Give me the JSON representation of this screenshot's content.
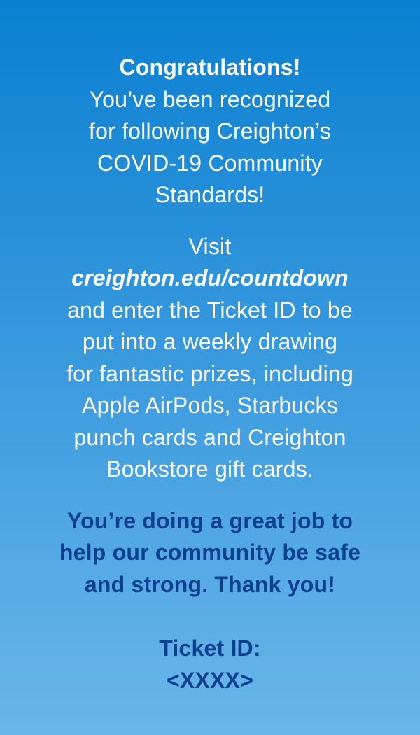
{
  "intro": {
    "headline": "Congratulations!",
    "lines": [
      "You’ve been recognized",
      "for following Creighton’s",
      "COVID-19 Community",
      "Standards!"
    ]
  },
  "visit": {
    "lead": "Visit",
    "url": "creighton.edu/countdown",
    "lines": [
      "and enter the Ticket ID to be",
      "put into a weekly drawing",
      "for fantastic prizes, including",
      "Apple AirPods, Starbucks",
      "punch cards and Creighton",
      "Bookstore gift cards."
    ]
  },
  "thanks": {
    "lines": [
      "You’re doing a great job to",
      "help our community be safe",
      "and strong. Thank you!"
    ]
  },
  "ticket": {
    "label": "Ticket ID:",
    "value": "<XXXX>"
  },
  "colors": {
    "background_top": "#0a80d0",
    "background_bottom": "#6ab6ea",
    "primary_text": "#ffffff",
    "accent_text": "#0d3f8f"
  }
}
